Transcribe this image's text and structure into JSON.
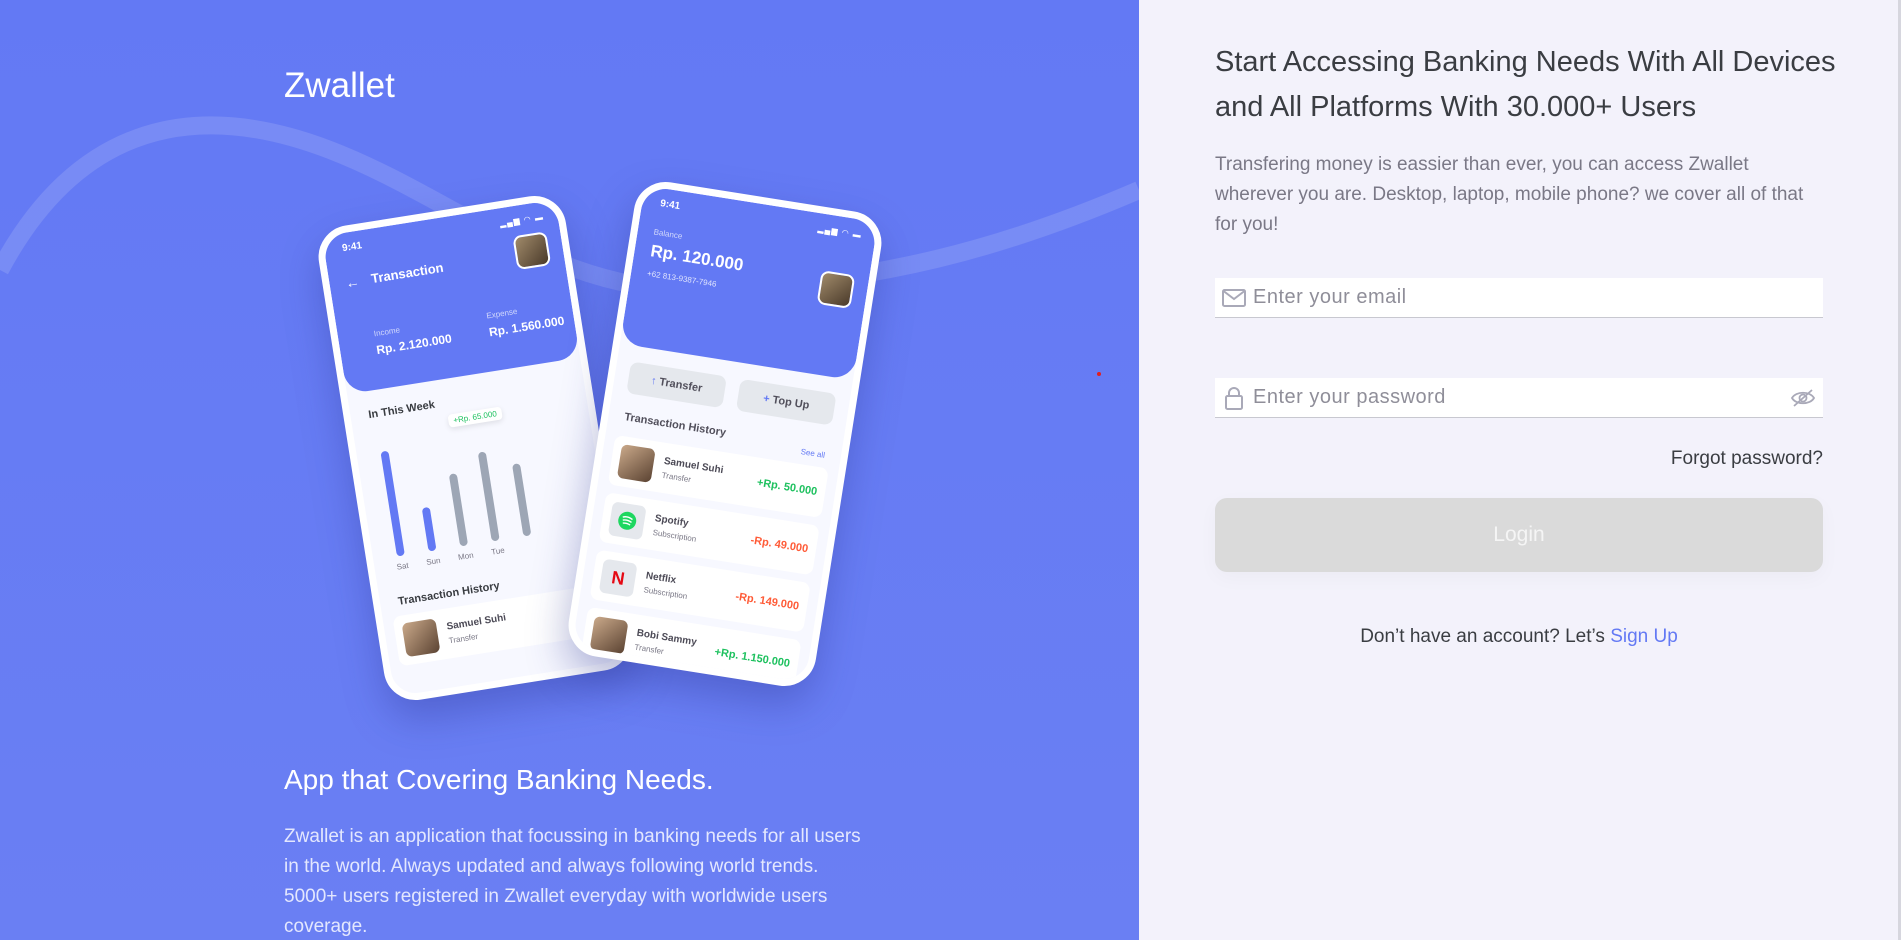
{
  "left": {
    "brand": "Zwallet",
    "tagline": "App that Covering Banking Needs.",
    "description": "Zwallet is an application that focussing in banking needs for all users in the world. Always updated and always following world trends. 5000+ users registered in Zwallet everyday with worldwide users coverage."
  },
  "phone1": {
    "time": "9:41",
    "title": "Transaction",
    "income_label": "Income",
    "income_value": "Rp. 2.120.000",
    "expense_label": "Expense",
    "expense_value": "Rp. 1.560.000",
    "week_title": "In This Week",
    "tooltip": "+Rp. 65.000",
    "days": [
      "Sat",
      "Sun",
      "Mon",
      "Tue"
    ],
    "bar_levels": [
      0.85,
      0.35,
      0.58,
      0.72,
      0.58
    ],
    "history_title": "Transaction History",
    "tx_name": "Samuel Suhi",
    "tx_type": "Transfer"
  },
  "phone2": {
    "time": "9:41",
    "balance_label": "Balance",
    "balance_value": "Rp. 120.000",
    "phone_number": "+62 813-9387-7946",
    "transfer_label": "Transfer",
    "topup_label": "Top Up",
    "history_title": "Transaction History",
    "see_all": "See all",
    "transactions": [
      {
        "name": "Samuel Suhi",
        "type": "Transfer",
        "amount": "+Rp. 50.000",
        "icon": "avatar-icon",
        "sign": "pos"
      },
      {
        "name": "Spotify",
        "type": "Subscription",
        "amount": "-Rp. 49.000",
        "icon": "spotify-icon",
        "sign": "neg"
      },
      {
        "name": "Netflix",
        "type": "Subscription",
        "amount": "-Rp. 149.000",
        "icon": "netflix-icon",
        "sign": "neg"
      },
      {
        "name": "Bobi Sammy",
        "type": "Transfer",
        "amount": "+Rp. 1.150.000",
        "icon": "avatar-icon",
        "sign": "pos"
      }
    ]
  },
  "right": {
    "headline": "Start Accessing Banking Needs With All Devices and All Platforms With 30.000+ Users",
    "subtext": "Transfering money is eassier than ever, you can access Zwallet wherever you are. Desktop, laptop, mobile phone? we cover all of that for you!",
    "email_placeholder": "Enter your email",
    "password_placeholder": "Enter your password",
    "forgot": "Forgot password?",
    "login": "Login",
    "signup_prefix": "Don’t have an account? Let’s ",
    "signup_link": "Sign Up"
  },
  "colors": {
    "primary": "#6379f4",
    "panel_bg": "#f3f2fb",
    "button_disabled": "#dadada",
    "positive": "#1ec15f",
    "negative": "#ff5b37"
  }
}
